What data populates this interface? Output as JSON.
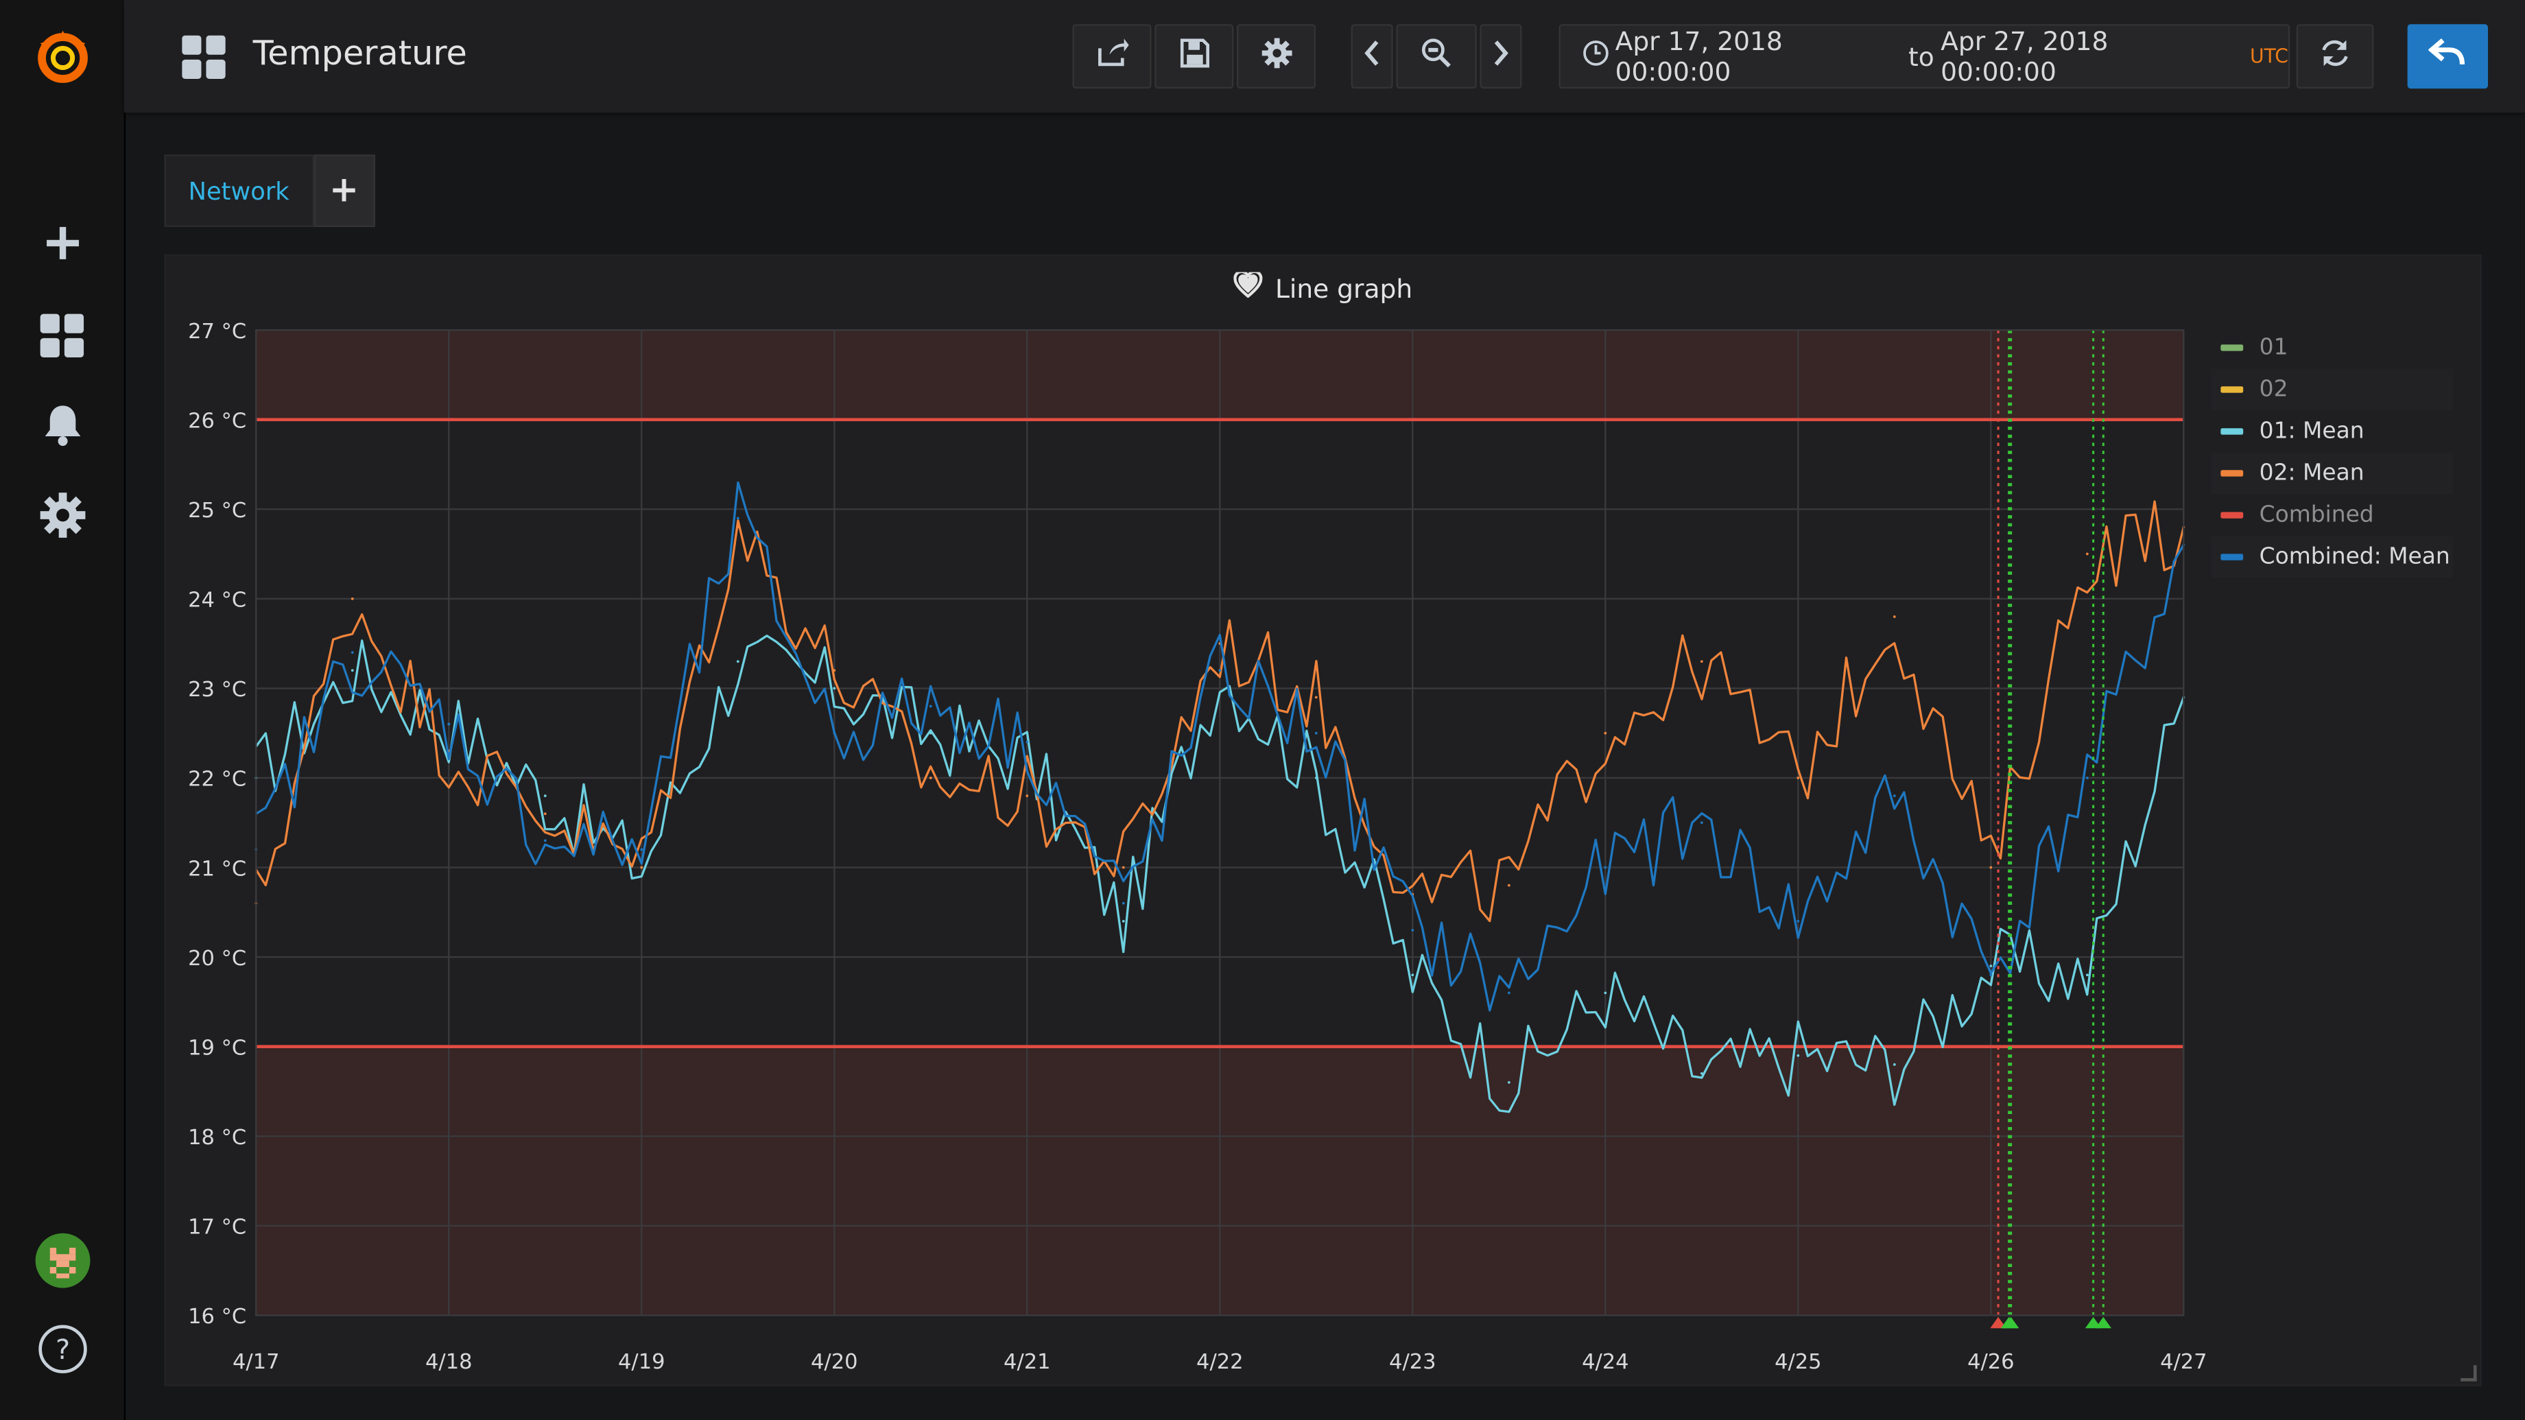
{
  "header": {
    "title": "Temperature",
    "time_from": "Apr 17, 2018 00:00:00",
    "time_to_word": "to",
    "time_to": "Apr 27, 2018 00:00:00",
    "timezone": "UTC"
  },
  "toolbar": {
    "icons": [
      "share-icon",
      "save-icon",
      "settings-icon",
      "chevron-left-icon",
      "zoom-out-icon",
      "chevron-right-icon",
      "refresh-icon",
      "back-icon"
    ]
  },
  "sidebar": {
    "items": [
      "grafana-logo",
      "add-icon",
      "dashboards-icon",
      "alerting-icon",
      "configuration-icon",
      "avatar",
      "help-icon"
    ]
  },
  "tabs": [
    {
      "label": "Network"
    }
  ],
  "add_tab_label": "+",
  "panel": {
    "title": "Line graph"
  },
  "colors": {
    "s01": "#7eb26d",
    "s02": "#eab839",
    "s01_mean": "#6ed0e0",
    "s02_mean": "#ef843c",
    "combined": "#e24d42",
    "combined_mean": "#1f78c1",
    "threshold": "#e24d42",
    "accent": "#1f78c1"
  },
  "legend": [
    {
      "label": "01",
      "color": "#7eb26d",
      "hidden": true
    },
    {
      "label": "02",
      "color": "#eab839",
      "hidden": true
    },
    {
      "label": "01: Mean",
      "color": "#6ed0e0",
      "hidden": false
    },
    {
      "label": "02: Mean",
      "color": "#ef843c",
      "hidden": false
    },
    {
      "label": "Combined",
      "color": "#e24d42",
      "hidden": true
    },
    {
      "label": "Combined: Mean",
      "color": "#1f78c1",
      "hidden": false
    }
  ],
  "chart_data": {
    "type": "line",
    "title": "Line graph",
    "xlabel": "",
    "ylabel": "",
    "y_unit": "°C",
    "ylim": [
      16,
      27
    ],
    "xlim": [
      "2018-04-17",
      "2018-04-27"
    ],
    "grid": true,
    "legend_position": "right",
    "x_ticks": [
      "4/17",
      "4/18",
      "4/19",
      "4/20",
      "4/21",
      "4/22",
      "4/23",
      "4/24",
      "4/25",
      "4/26",
      "4/27"
    ],
    "y_ticks": [
      "16 °C",
      "17 °C",
      "18 °C",
      "19 °C",
      "20 °C",
      "21 °C",
      "22 °C",
      "23 °C",
      "24 °C",
      "25 °C",
      "26 °C",
      "27 °C"
    ],
    "thresholds": [
      {
        "value": 26,
        "op": "gt",
        "color": "#e24d42"
      },
      {
        "value": 19,
        "op": "lt",
        "color": "#e24d42"
      }
    ],
    "x": [
      "2018-04-17",
      "2018-04-17 12:00",
      "2018-04-18",
      "2018-04-18 12:00",
      "2018-04-19",
      "2018-04-19 12:00",
      "2018-04-20",
      "2018-04-20 12:00",
      "2018-04-21",
      "2018-04-21 12:00",
      "2018-04-22",
      "2018-04-22 12:00",
      "2018-04-23",
      "2018-04-23 12:00",
      "2018-04-24",
      "2018-04-24 12:00",
      "2018-04-25",
      "2018-04-25 12:00",
      "2018-04-26",
      "2018-04-26 12:00",
      "2018-04-27"
    ],
    "series": [
      {
        "name": "01: Mean",
        "color": "#6ed0e0",
        "values": [
          22.0,
          23.2,
          22.6,
          21.8,
          21.0,
          23.3,
          23.0,
          22.5,
          22.2,
          20.4,
          23.2,
          22.0,
          19.8,
          18.6,
          19.6,
          18.7,
          18.9,
          18.8,
          19.9,
          19.8,
          22.9
        ]
      },
      {
        "name": "02: Mean",
        "color": "#ef843c",
        "values": [
          20.6,
          24.0,
          22.3,
          21.6,
          21.0,
          24.8,
          23.2,
          22.0,
          21.8,
          21.0,
          23.5,
          22.9,
          20.7,
          20.8,
          22.5,
          23.3,
          22.0,
          23.8,
          21.0,
          24.5,
          24.8
        ]
      },
      {
        "name": "Combined: Mean",
        "color": "#1f78c1",
        "values": [
          21.2,
          23.4,
          22.6,
          21.3,
          21.2,
          24.9,
          22.5,
          22.8,
          22.4,
          20.6,
          23.2,
          22.5,
          20.3,
          19.6,
          21.0,
          21.5,
          20.4,
          21.8,
          19.8,
          22.0,
          24.6
        ]
      }
    ],
    "annotations": [
      {
        "x": "2018-04-26 00:55",
        "color": "#e24d42"
      },
      {
        "x": "2018-04-26 02:15",
        "color": "#37c837"
      },
      {
        "x": "2018-04-26 02:30",
        "color": "#37c837"
      },
      {
        "x": "2018-04-26 12:45",
        "color": "#37c837"
      },
      {
        "x": "2018-04-26 14:00",
        "color": "#37c837"
      }
    ]
  }
}
